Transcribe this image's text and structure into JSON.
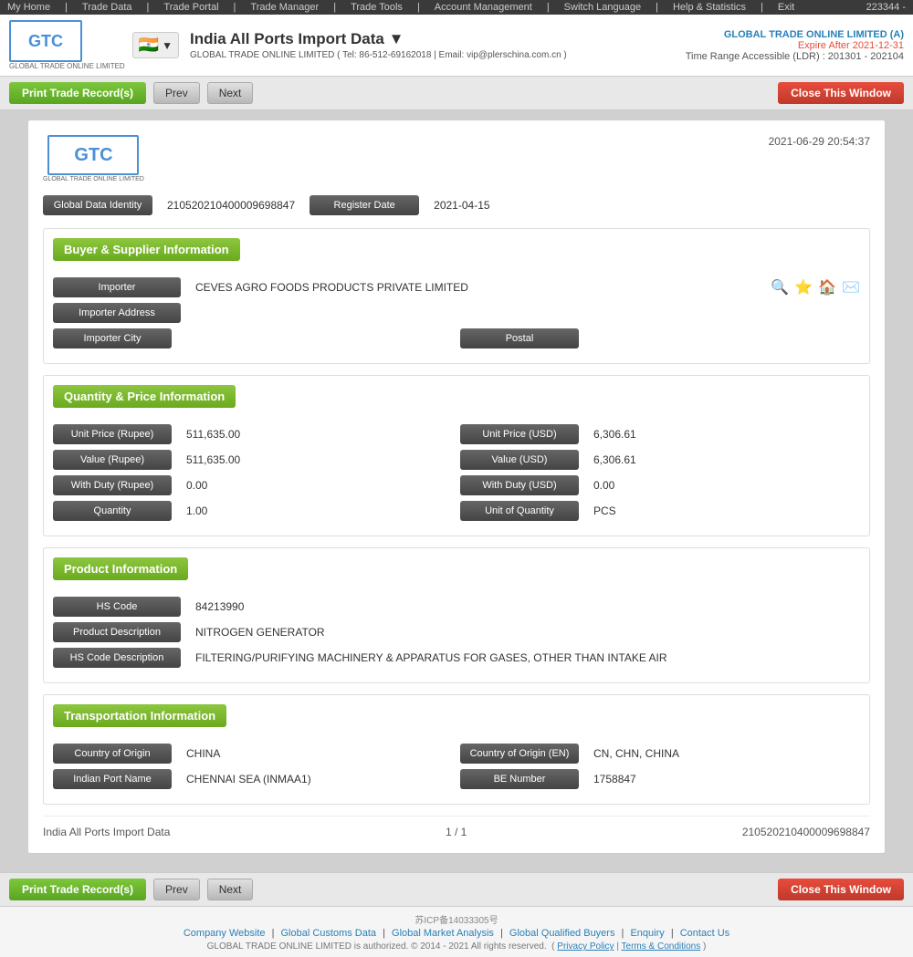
{
  "topbar": {
    "user_id": "223344 -",
    "nav": [
      "My Home",
      "Trade Data",
      "Trade Portal",
      "Trade Manager",
      "Trade Tools",
      "Account Management",
      "Switch Language",
      "Help & Statistics",
      "Exit"
    ]
  },
  "header": {
    "logo_text": "GTC",
    "logo_subtitle": "GLOBAL TRADE ONLINE LIMITED",
    "title": "India All Ports Import Data ▼",
    "contact": "GLOBAL TRADE ONLINE LIMITED ( Tel: 86-512-69162018 | Email: vip@plerschina.com.cn )",
    "company": "GLOBAL TRADE ONLINE LIMITED (A)",
    "expire": "Expire After 2021-12-31",
    "range": "Time Range Accessible (LDR) : 201301 - 202104"
  },
  "action_bar": {
    "print_label": "Print Trade Record(s)",
    "prev_label": "Prev",
    "next_label": "Next",
    "close_label": "Close This Window"
  },
  "record": {
    "timestamp": "2021-06-29 20:54:37",
    "logo_text": "GTC",
    "logo_subtitle": "GLOBAL TRADE ONLINE LIMITED",
    "global_data_identity_label": "Global Data Identity",
    "global_data_identity_value": "210520210400009698847",
    "register_date_label": "Register Date",
    "register_date_value": "2021-04-15",
    "sections": {
      "buyer_supplier": {
        "title": "Buyer & Supplier Information",
        "importer_label": "Importer",
        "importer_value": "CEVES AGRO FOODS PRODUCTS PRIVATE LIMITED",
        "importer_address_label": "Importer Address",
        "importer_address_value": "",
        "importer_city_label": "Importer City",
        "importer_city_value": "",
        "postal_label": "Postal",
        "postal_value": ""
      },
      "quantity_price": {
        "title": "Quantity & Price Information",
        "unit_price_rupee_label": "Unit Price (Rupee)",
        "unit_price_rupee_value": "511,635.00",
        "unit_price_usd_label": "Unit Price (USD)",
        "unit_price_usd_value": "6,306.61",
        "value_rupee_label": "Value (Rupee)",
        "value_rupee_value": "511,635.00",
        "value_usd_label": "Value (USD)",
        "value_usd_value": "6,306.61",
        "with_duty_rupee_label": "With Duty (Rupee)",
        "with_duty_rupee_value": "0.00",
        "with_duty_usd_label": "With Duty (USD)",
        "with_duty_usd_value": "0.00",
        "quantity_label": "Quantity",
        "quantity_value": "1.00",
        "unit_of_quantity_label": "Unit of Quantity",
        "unit_of_quantity_value": "PCS"
      },
      "product": {
        "title": "Product Information",
        "hs_code_label": "HS Code",
        "hs_code_value": "84213990",
        "product_description_label": "Product Description",
        "product_description_value": "NITROGEN GENERATOR",
        "hs_code_description_label": "HS Code Description",
        "hs_code_description_value": "FILTERING/PURIFYING MACHINERY & APPARATUS FOR GASES, OTHER THAN INTAKE AIR"
      },
      "transportation": {
        "title": "Transportation Information",
        "country_of_origin_label": "Country of Origin",
        "country_of_origin_value": "CHINA",
        "country_of_origin_en_label": "Country of Origin (EN)",
        "country_of_origin_en_value": "CN, CHN, CHINA",
        "indian_port_name_label": "Indian Port Name",
        "indian_port_name_value": "CHENNAI SEA (INMAA1)",
        "be_number_label": "BE Number",
        "be_number_value": "1758847"
      }
    },
    "footer": {
      "source": "India All Ports Import Data",
      "pagination": "1 / 1",
      "record_id": "210520210400009698847"
    }
  },
  "bottom_action_bar": {
    "print_label": "Print Trade Record(s)",
    "prev_label": "Prev",
    "next_label": "Next",
    "close_label": "Close This Window"
  },
  "footer": {
    "beian": "苏ICP备14033305号",
    "links": [
      "Company Website",
      "Global Customs Data",
      "Global Market Analysis",
      "Global Qualified Buyers",
      "Enquiry",
      "Contact Us"
    ],
    "copyright": "GLOBAL TRADE ONLINE LIMITED is authorized. © 2014 - 2021 All rights reserved.",
    "privacy": "Privacy Policy",
    "terms": "Terms & Conditions"
  }
}
